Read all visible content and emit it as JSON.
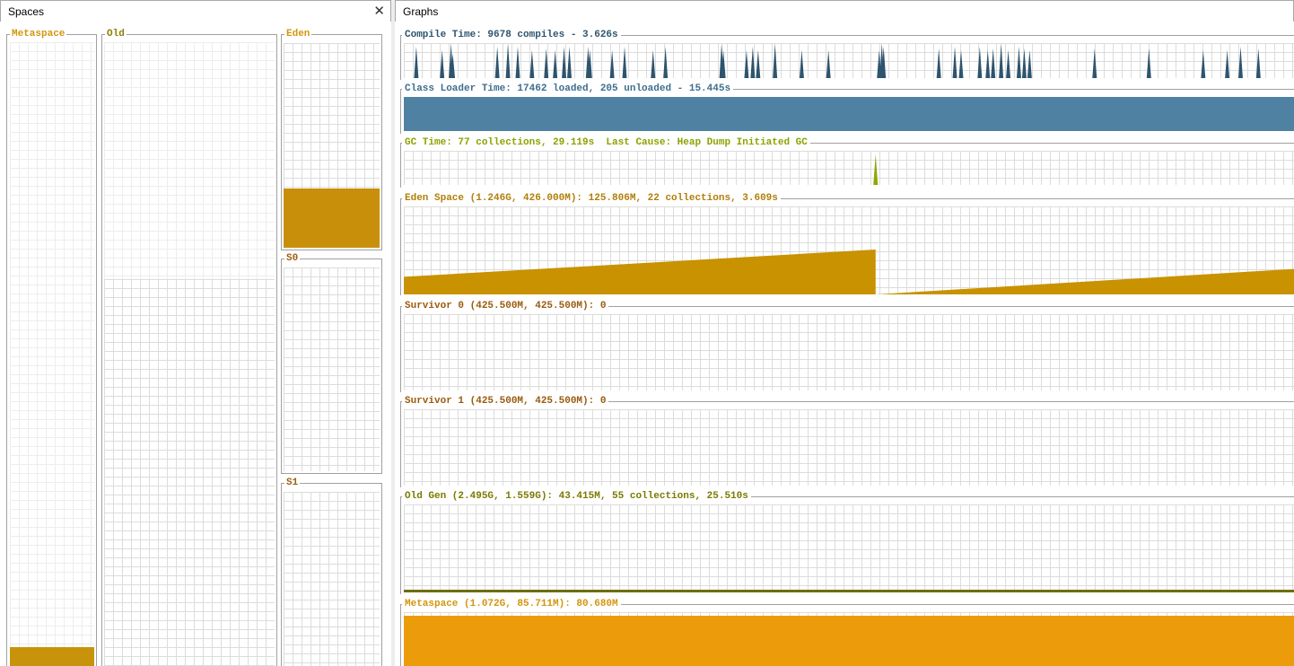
{
  "spaces": {
    "tab_label": "Spaces",
    "close_icon": "close-icon",
    "boxes": {
      "metaspace": {
        "label": "Metaspace",
        "color": "#C8930A",
        "title_color": "#D4950E",
        "used_fraction": 0.03
      },
      "old": {
        "label": "Old",
        "color": "#808000",
        "title_color": "#8B8000",
        "capacity_fraction": 0.62,
        "used_fraction": 0.0
      },
      "eden": {
        "label": "Eden",
        "color": "#C8900A",
        "title_color": "#D4950E",
        "used_fraction": 0.29
      },
      "s0": {
        "label": "S0",
        "color": "#A05A00",
        "title_color": "#9C5F10",
        "used_fraction": 0.0
      },
      "s1": {
        "label": "S1",
        "color": "#A05A00",
        "title_color": "#9C5F10",
        "used_fraction": 0.0
      }
    }
  },
  "graphs": {
    "tab_label": "Graphs",
    "compile": {
      "title": "Compile Time: 9678 compiles - 3.626s",
      "color": "#2E546E",
      "spikes": [
        {
          "x": 0.014,
          "h": 0.9
        },
        {
          "x": 0.043,
          "h": 0.8
        },
        {
          "x": 0.053,
          "h": 1.0
        },
        {
          "x": 0.055,
          "h": 0.7
        },
        {
          "x": 0.105,
          "h": 0.9
        },
        {
          "x": 0.117,
          "h": 1.0
        },
        {
          "x": 0.128,
          "h": 0.9
        },
        {
          "x": 0.144,
          "h": 0.8
        },
        {
          "x": 0.16,
          "h": 0.85
        },
        {
          "x": 0.17,
          "h": 0.8
        },
        {
          "x": 0.18,
          "h": 0.9
        },
        {
          "x": 0.186,
          "h": 0.9
        },
        {
          "x": 0.207,
          "h": 0.9
        },
        {
          "x": 0.209,
          "h": 0.8
        },
        {
          "x": 0.234,
          "h": 0.8
        },
        {
          "x": 0.248,
          "h": 0.9
        },
        {
          "x": 0.28,
          "h": 0.8
        },
        {
          "x": 0.294,
          "h": 0.9
        },
        {
          "x": 0.357,
          "h": 1.0
        },
        {
          "x": 0.359,
          "h": 0.8
        },
        {
          "x": 0.385,
          "h": 0.8
        },
        {
          "x": 0.392,
          "h": 0.9
        },
        {
          "x": 0.398,
          "h": 0.8
        },
        {
          "x": 0.417,
          "h": 1.0
        },
        {
          "x": 0.447,
          "h": 0.8
        },
        {
          "x": 0.477,
          "h": 0.8
        },
        {
          "x": 0.534,
          "h": 0.8
        },
        {
          "x": 0.537,
          "h": 1.0
        },
        {
          "x": 0.539,
          "h": 0.9
        },
        {
          "x": 0.601,
          "h": 0.85
        },
        {
          "x": 0.619,
          "h": 0.9
        },
        {
          "x": 0.626,
          "h": 0.8
        },
        {
          "x": 0.647,
          "h": 0.9
        },
        {
          "x": 0.656,
          "h": 0.8
        },
        {
          "x": 0.662,
          "h": 0.85
        },
        {
          "x": 0.671,
          "h": 1.0
        },
        {
          "x": 0.679,
          "h": 0.8
        },
        {
          "x": 0.691,
          "h": 0.9
        },
        {
          "x": 0.697,
          "h": 0.85
        },
        {
          "x": 0.703,
          "h": 0.8
        },
        {
          "x": 0.776,
          "h": 0.85
        },
        {
          "x": 0.837,
          "h": 0.85
        },
        {
          "x": 0.898,
          "h": 0.8
        },
        {
          "x": 0.925,
          "h": 0.8
        },
        {
          "x": 0.94,
          "h": 0.9
        },
        {
          "x": 0.96,
          "h": 0.85
        }
      ]
    },
    "classloader": {
      "title": "Class Loader Time: 17462 loaded, 205 unloaded - 15.445s",
      "color": "#4F82A2",
      "title_color": "#3E6E8E",
      "fill_fraction": 1.0
    },
    "gc": {
      "title": "GC Time: 77 collections, 29.119s  Last Cause: Heap Dump Initiated GC",
      "color": "#8FA800",
      "title_color": "#8DA100",
      "spikes": [
        {
          "x": 0.53,
          "h": 0.9
        }
      ]
    },
    "eden": {
      "title": "Eden Space (1.246G, 426.000M): 125.806M, 22 collections, 3.609s",
      "color": "#C89200",
      "title_color": "#B07F0A",
      "points": [
        [
          0,
          0.2
        ],
        [
          0.53,
          0.51
        ],
        [
          0.53,
          0.0
        ],
        [
          1.0,
          0.29
        ]
      ]
    },
    "survivor0": {
      "title": "Survivor 0 (425.500M, 425.500M): 0",
      "color": "#A05A00",
      "title_color": "#9A5A0C"
    },
    "survivor1": {
      "title": "Survivor 1 (425.500M, 425.500M): 0",
      "color": "#A05A00",
      "title_color": "#9A5A0C"
    },
    "oldgen": {
      "title": "Old Gen (2.495G, 1.559G): 43.415M, 55 collections, 25.510s",
      "color": "#6E6E00",
      "title_color": "#7A7A00",
      "fill_fraction": 0.03
    },
    "metaspace": {
      "title": "Metaspace (1.072G, 85.711M): 80.680M",
      "color": "#EC9C0A",
      "title_color": "#D4950E",
      "fill_fraction": 0.94
    }
  }
}
